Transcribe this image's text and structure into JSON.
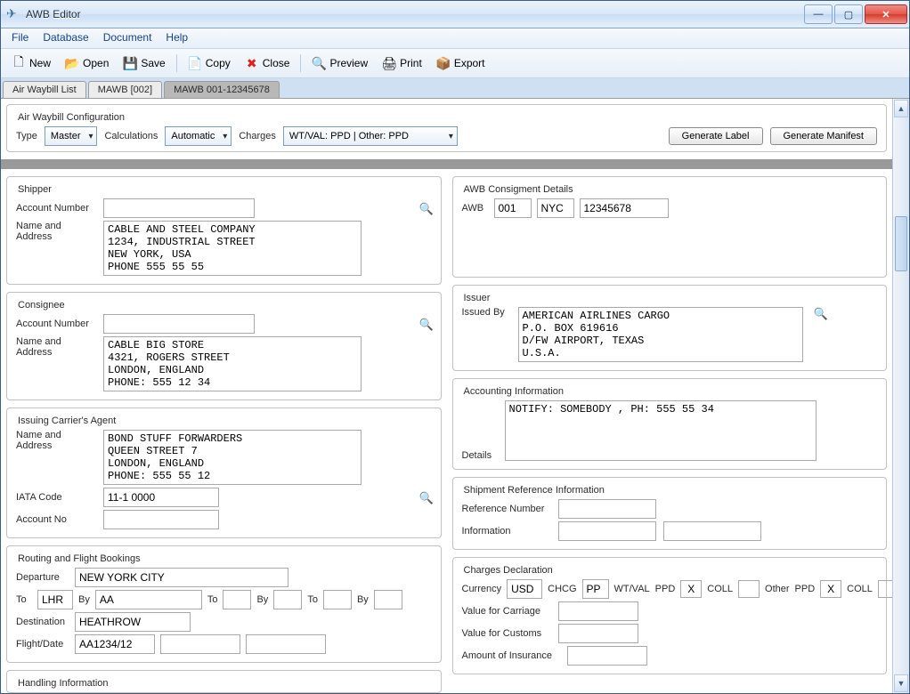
{
  "window": {
    "title": "AWB Editor"
  },
  "menu": {
    "file": "File",
    "database": "Database",
    "document": "Document",
    "help": "Help"
  },
  "toolbar": {
    "new": "New",
    "open": "Open",
    "save": "Save",
    "copy": "Copy",
    "close": "Close",
    "preview": "Preview",
    "print": "Print",
    "export": "Export"
  },
  "tabs": {
    "list": "Air Waybill List",
    "mawb_short": "MAWB  [002]",
    "mawb_full": "MAWB 001-12345678"
  },
  "config": {
    "title": "Air Waybill Configuration",
    "type_label": "Type",
    "type_value": "Master",
    "calc_label": "Calculations",
    "calc_value": "Automatic",
    "charges_label": "Charges",
    "charges_value": "WT/VAL: PPD | Other: PPD",
    "gen_label": "Generate Label",
    "gen_manifest": "Generate Manifest"
  },
  "shipper": {
    "title": "Shipper",
    "account_label": "Account Number",
    "name_label": "Name and Address",
    "address": "CABLE AND STEEL COMPANY\n1234, INDUSTRIAL STREET\nNEW YORK, USA\nPHONE 555 55 55"
  },
  "consignee": {
    "title": "Consignee",
    "account_label": "Account Number",
    "name_label": "Name and Address",
    "address": "CABLE BIG STORE\n4321, ROGERS STREET\nLONDON, ENGLAND\nPHONE: 555 12 34"
  },
  "agent": {
    "title": "Issuing Carrier's Agent",
    "name_label": "Name and Address",
    "address": "BOND STUFF FORWARDERS\nQUEEN STREET 7\nLONDON, ENGLAND\nPHONE: 555 55 12",
    "iata_label": "IATA Code",
    "iata_value": "11-1 0000",
    "account_label": "Account No"
  },
  "routing": {
    "title": "Routing and Flight Bookings",
    "departure_label": "Departure",
    "departure_value": "NEW YORK CITY",
    "to_label": "To",
    "to1": "LHR",
    "by_label": "By",
    "by1": "AA",
    "destination_label": "Destination",
    "destination_value": "HEATHROW",
    "flight_label": "Flight/Date",
    "flight_value": "AA1234/12"
  },
  "handling": {
    "title": "Handling Information"
  },
  "awbdet": {
    "title": "AWB Consigment Details",
    "awb_label": "AWB",
    "p1": "001",
    "p2": "NYC",
    "p3": "12345678"
  },
  "issuer": {
    "title": "Issuer",
    "label": "Issued By",
    "text": "AMERICAN AIRLINES CARGO\nP.O. BOX 619616\nD/FW AIRPORT, TEXAS\nU.S.A."
  },
  "accounting": {
    "title": "Accounting Information",
    "details_label": "Details",
    "text": "NOTIFY: SOMEBODY , PH: 555 55 34"
  },
  "shipref": {
    "title": "Shipment Reference Information",
    "ref_label": "Reference Number",
    "info_label": "Information"
  },
  "charges": {
    "title": "Charges Declaration",
    "currency_label": "Currency",
    "currency_value": "USD",
    "chcg_label": "CHCG",
    "chcg_value": "PP",
    "wtval_label": "WT/VAL",
    "ppd_label": "PPD",
    "coll_label": "COLL",
    "other_label": "Other",
    "x": "X",
    "carriage_label": "Value for Carriage",
    "customs_label": "Value for Customs",
    "insurance_label": "Amount of Insurance"
  }
}
